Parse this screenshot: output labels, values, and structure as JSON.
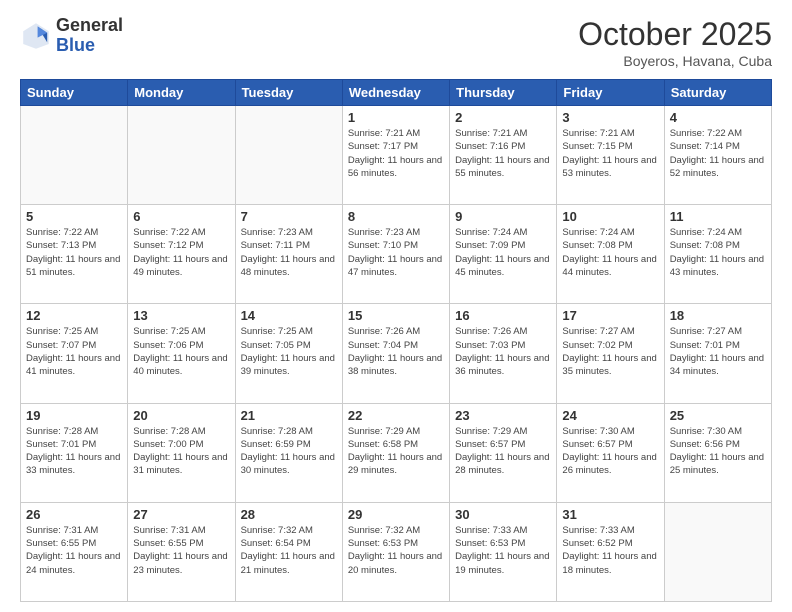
{
  "logo": {
    "general": "General",
    "blue": "Blue"
  },
  "header": {
    "month": "October 2025",
    "location": "Boyeros, Havana, Cuba"
  },
  "days_of_week": [
    "Sunday",
    "Monday",
    "Tuesday",
    "Wednesday",
    "Thursday",
    "Friday",
    "Saturday"
  ],
  "weeks": [
    [
      {
        "day": "",
        "info": ""
      },
      {
        "day": "",
        "info": ""
      },
      {
        "day": "",
        "info": ""
      },
      {
        "day": "1",
        "info": "Sunrise: 7:21 AM\nSunset: 7:17 PM\nDaylight: 11 hours and 56 minutes."
      },
      {
        "day": "2",
        "info": "Sunrise: 7:21 AM\nSunset: 7:16 PM\nDaylight: 11 hours and 55 minutes."
      },
      {
        "day": "3",
        "info": "Sunrise: 7:21 AM\nSunset: 7:15 PM\nDaylight: 11 hours and 53 minutes."
      },
      {
        "day": "4",
        "info": "Sunrise: 7:22 AM\nSunset: 7:14 PM\nDaylight: 11 hours and 52 minutes."
      }
    ],
    [
      {
        "day": "5",
        "info": "Sunrise: 7:22 AM\nSunset: 7:13 PM\nDaylight: 11 hours and 51 minutes."
      },
      {
        "day": "6",
        "info": "Sunrise: 7:22 AM\nSunset: 7:12 PM\nDaylight: 11 hours and 49 minutes."
      },
      {
        "day": "7",
        "info": "Sunrise: 7:23 AM\nSunset: 7:11 PM\nDaylight: 11 hours and 48 minutes."
      },
      {
        "day": "8",
        "info": "Sunrise: 7:23 AM\nSunset: 7:10 PM\nDaylight: 11 hours and 47 minutes."
      },
      {
        "day": "9",
        "info": "Sunrise: 7:24 AM\nSunset: 7:09 PM\nDaylight: 11 hours and 45 minutes."
      },
      {
        "day": "10",
        "info": "Sunrise: 7:24 AM\nSunset: 7:08 PM\nDaylight: 11 hours and 44 minutes."
      },
      {
        "day": "11",
        "info": "Sunrise: 7:24 AM\nSunset: 7:08 PM\nDaylight: 11 hours and 43 minutes."
      }
    ],
    [
      {
        "day": "12",
        "info": "Sunrise: 7:25 AM\nSunset: 7:07 PM\nDaylight: 11 hours and 41 minutes."
      },
      {
        "day": "13",
        "info": "Sunrise: 7:25 AM\nSunset: 7:06 PM\nDaylight: 11 hours and 40 minutes."
      },
      {
        "day": "14",
        "info": "Sunrise: 7:25 AM\nSunset: 7:05 PM\nDaylight: 11 hours and 39 minutes."
      },
      {
        "day": "15",
        "info": "Sunrise: 7:26 AM\nSunset: 7:04 PM\nDaylight: 11 hours and 38 minutes."
      },
      {
        "day": "16",
        "info": "Sunrise: 7:26 AM\nSunset: 7:03 PM\nDaylight: 11 hours and 36 minutes."
      },
      {
        "day": "17",
        "info": "Sunrise: 7:27 AM\nSunset: 7:02 PM\nDaylight: 11 hours and 35 minutes."
      },
      {
        "day": "18",
        "info": "Sunrise: 7:27 AM\nSunset: 7:01 PM\nDaylight: 11 hours and 34 minutes."
      }
    ],
    [
      {
        "day": "19",
        "info": "Sunrise: 7:28 AM\nSunset: 7:01 PM\nDaylight: 11 hours and 33 minutes."
      },
      {
        "day": "20",
        "info": "Sunrise: 7:28 AM\nSunset: 7:00 PM\nDaylight: 11 hours and 31 minutes."
      },
      {
        "day": "21",
        "info": "Sunrise: 7:28 AM\nSunset: 6:59 PM\nDaylight: 11 hours and 30 minutes."
      },
      {
        "day": "22",
        "info": "Sunrise: 7:29 AM\nSunset: 6:58 PM\nDaylight: 11 hours and 29 minutes."
      },
      {
        "day": "23",
        "info": "Sunrise: 7:29 AM\nSunset: 6:57 PM\nDaylight: 11 hours and 28 minutes."
      },
      {
        "day": "24",
        "info": "Sunrise: 7:30 AM\nSunset: 6:57 PM\nDaylight: 11 hours and 26 minutes."
      },
      {
        "day": "25",
        "info": "Sunrise: 7:30 AM\nSunset: 6:56 PM\nDaylight: 11 hours and 25 minutes."
      }
    ],
    [
      {
        "day": "26",
        "info": "Sunrise: 7:31 AM\nSunset: 6:55 PM\nDaylight: 11 hours and 24 minutes."
      },
      {
        "day": "27",
        "info": "Sunrise: 7:31 AM\nSunset: 6:55 PM\nDaylight: 11 hours and 23 minutes."
      },
      {
        "day": "28",
        "info": "Sunrise: 7:32 AM\nSunset: 6:54 PM\nDaylight: 11 hours and 21 minutes."
      },
      {
        "day": "29",
        "info": "Sunrise: 7:32 AM\nSunset: 6:53 PM\nDaylight: 11 hours and 20 minutes."
      },
      {
        "day": "30",
        "info": "Sunrise: 7:33 AM\nSunset: 6:53 PM\nDaylight: 11 hours and 19 minutes."
      },
      {
        "day": "31",
        "info": "Sunrise: 7:33 AM\nSunset: 6:52 PM\nDaylight: 11 hours and 18 minutes."
      },
      {
        "day": "",
        "info": ""
      }
    ]
  ]
}
